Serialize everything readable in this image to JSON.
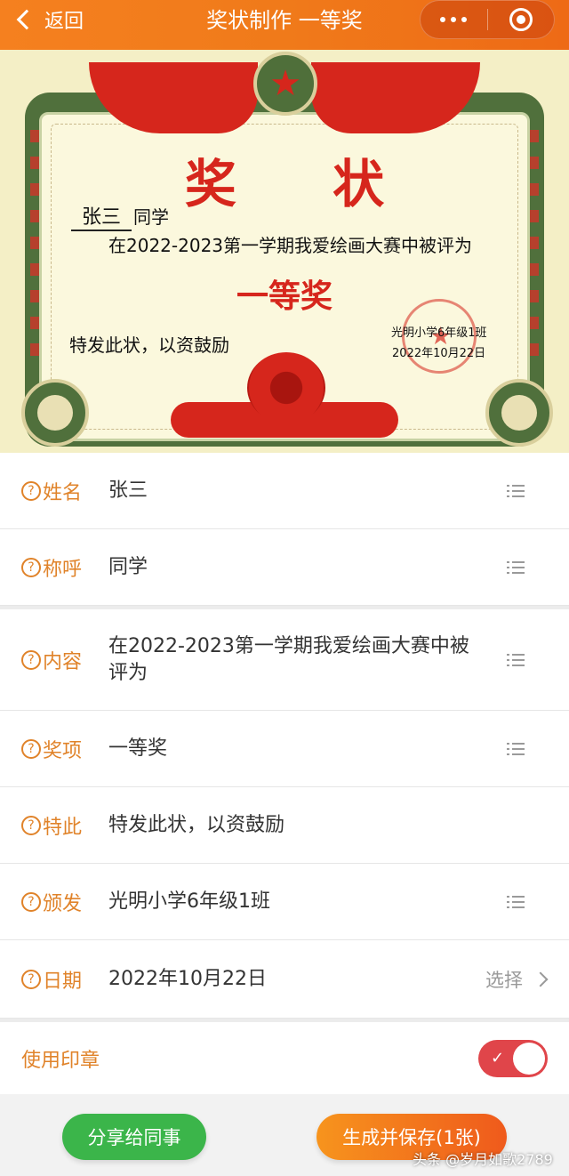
{
  "header": {
    "back_label": "返回",
    "title": "奖状制作 一等奖"
  },
  "certificate": {
    "heading": "奖 状",
    "name": "张三",
    "address": "同学",
    "content": "在2022-2023第一学期我爱绘画大赛中被评为",
    "award": "一等奖",
    "encourage": "特发此状，以资鼓励",
    "issuer": "光明小学6年级1班",
    "date": "2022年10月22日"
  },
  "form": {
    "name": {
      "label": "姓名",
      "value": "张三"
    },
    "address": {
      "label": "称呼",
      "value": "同学"
    },
    "content": {
      "label": "内容",
      "value": "在2022-2023第一学期我爱绘画大赛中被评为"
    },
    "award": {
      "label": "奖项",
      "value": "一等奖"
    },
    "special": {
      "label": "特此",
      "value": "特发此状，以资鼓励"
    },
    "issuer": {
      "label": "颁发",
      "value": "光明小学6年级1班"
    },
    "date": {
      "label": "日期",
      "value": "2022年10月22日",
      "action": "选择"
    },
    "seal": {
      "label": "使用印章",
      "enabled": true
    }
  },
  "buttons": {
    "share": "分享给同事",
    "generate": "生成并保存(1张)"
  },
  "watermark": "头条 @岁月如歌2789",
  "colors": {
    "header": "#f07a1a",
    "label": "#e0832a",
    "share_button": "#3bb54a",
    "generate_button": "#ef5a1c",
    "toggle_on": "#e0454a",
    "certificate_red": "#d6261c",
    "frame_green": "#50703c"
  },
  "icons": {
    "back": "chevron-left-icon",
    "more": "more-dots-icon",
    "close": "target-circle-icon",
    "help": "question-circle-icon",
    "list": "list-icon",
    "select": "chevron-right-icon"
  }
}
